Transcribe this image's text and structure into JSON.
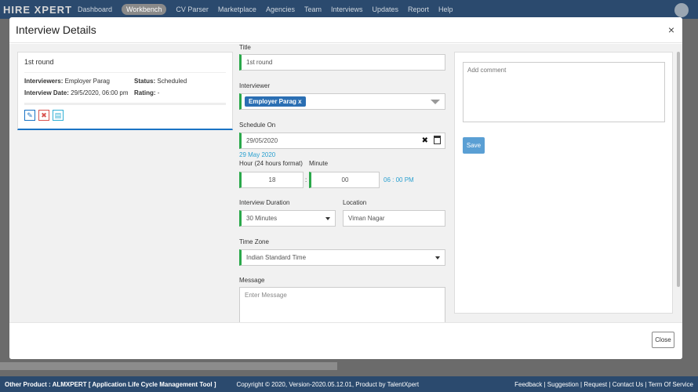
{
  "nav": {
    "logo": "HIRE XPERT",
    "items": [
      {
        "label": "Dashboard",
        "active": false
      },
      {
        "label": "Workbench",
        "active": true
      },
      {
        "label": "CV Parser",
        "active": false
      },
      {
        "label": "Marketplace",
        "active": false
      },
      {
        "label": "Agencies",
        "active": false
      },
      {
        "label": "Team",
        "active": false
      },
      {
        "label": "Interviews",
        "active": false
      },
      {
        "label": "Updates",
        "active": false
      },
      {
        "label": "Report",
        "active": false
      },
      {
        "label": "Help",
        "active": false
      }
    ]
  },
  "modal": {
    "title": "Interview Details",
    "close_symbol": "×",
    "footer_close_label": "Close"
  },
  "card": {
    "round": "1st round",
    "interviewers_label": "Interviewers:",
    "interviewers_value": "Employer Parag",
    "status_label": "Status:",
    "status_value": "Scheduled",
    "date_label": "Interview Date:",
    "date_value": "29/5/2020, 06:00 pm",
    "rating_label": "Rating:",
    "rating_value": "-"
  },
  "form": {
    "title_label": "Title",
    "title_value": "1st round",
    "interviewer_label": "Interviewer",
    "interviewer_tag": "Employer Parag",
    "interviewer_tag_remove": "x",
    "schedule_label": "Schedule On",
    "schedule_value": "29/05/2020",
    "schedule_clear": "✖",
    "schedule_hint": "29 May 2020",
    "hour_label": "Hour (24 hours format)",
    "hour_value": "18",
    "minute_label": "Minute",
    "minute_value": "00",
    "time_separator": ":",
    "time_hint": "06 : 00 PM",
    "duration_label": "Interview Duration",
    "duration_value": "30 Minutes",
    "location_label": "Location",
    "location_value": "Viman Nagar",
    "timezone_label": "Time Zone",
    "timezone_value": "Indian Standard Time",
    "message_label": "Message",
    "message_placeholder": "Enter Message"
  },
  "comment": {
    "placeholder": "Add comment",
    "save_label": "Save"
  },
  "footer": {
    "other_product": "Other Product : ALMXPERT [ Application Life Cycle Management Tool ]",
    "copyright": "Copyright © 2020, Version-2020.05.12.01, Product by TalentXpert",
    "links": [
      "Feedback",
      "Suggestion",
      "Request",
      "Contact Us",
      "Term Of Service"
    ],
    "separator": " | "
  }
}
